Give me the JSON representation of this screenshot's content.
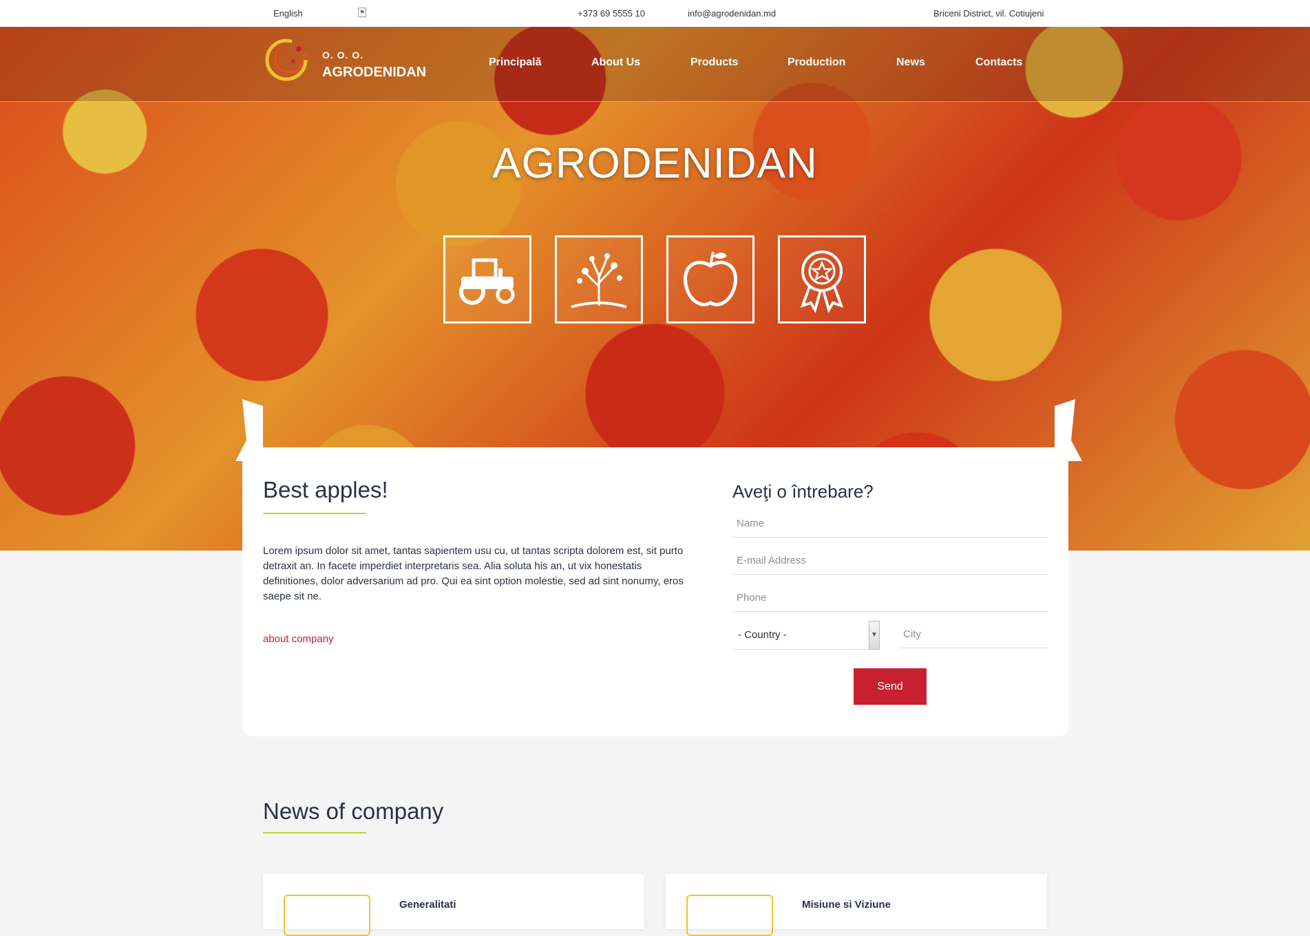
{
  "topbar": {
    "language": "English",
    "flag_icon": "flag-icon",
    "phone": "+373 69 5555 10",
    "email": "info@agrodenidan.md",
    "address": "Briceni District, vil. Cotiujeni"
  },
  "logo": {
    "small": "O. O. O.",
    "big": "AGRODENIDAN"
  },
  "nav": {
    "items": [
      "Principală",
      "About Us",
      "Products",
      "Production",
      "News",
      "Contacts"
    ]
  },
  "hero": {
    "title": "AGRODENIDAN",
    "icons": [
      "tractor-icon",
      "tree-icon",
      "apple-icon",
      "award-icon"
    ]
  },
  "about": {
    "title": "Best apples!",
    "text": "Lorem ipsum dolor sit amet, tantas sapientem usu cu, ut tantas scripta dolorem est, sit purto detraxit an. In facete imperdiet interpretaris sea. Alia soluta his an, ut vix honestatis definitiones, dolor adversarium ad pro. Qui ea sint option molestie, sed ad sint nonumy, eros saepe sit ne.",
    "link": "about company"
  },
  "form": {
    "title": "Aveţi o întrebare?",
    "name_placeholder": "Name",
    "email_placeholder": "E-mail Address",
    "phone_placeholder": "Phone",
    "country_selected": "- Country -",
    "city_placeholder": "City",
    "send_label": "Send"
  },
  "news": {
    "title": "News of company",
    "items": [
      {
        "title": "Generalitati"
      },
      {
        "title": "Misiune si Viziune"
      }
    ]
  },
  "colors": {
    "accent": "#c8202f",
    "underline": "#b9d23a",
    "heading": "#2a3142"
  }
}
